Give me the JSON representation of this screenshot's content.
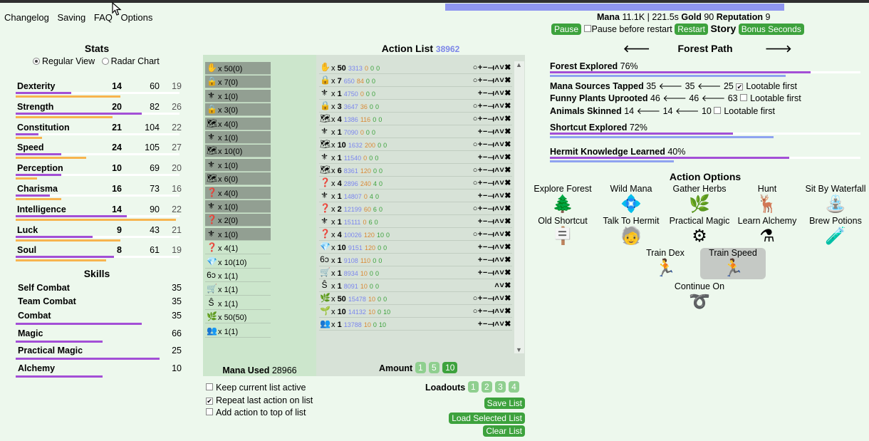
{
  "menu": [
    "Changelog",
    "Saving",
    "FAQ",
    "Options"
  ],
  "stats": {
    "title": "Stats",
    "view_regular": "Regular View",
    "view_radar": "Radar Chart",
    "rows": [
      {
        "name": "Dexterity",
        "level": "14",
        "talent": "60",
        "soul": "19",
        "level_frac": 0.34,
        "talent_frac": 0.64
      },
      {
        "name": "Strength",
        "level": "20",
        "talent": "82",
        "soul": "26",
        "level_frac": 0.77,
        "talent_frac": 0.59
      },
      {
        "name": "Constitution",
        "level": "21",
        "talent": "104",
        "soul": "22",
        "level_frac": 0.14,
        "talent_frac": 0.16
      },
      {
        "name": "Speed",
        "level": "24",
        "talent": "105",
        "soul": "27",
        "level_frac": 0.28,
        "talent_frac": 0.43
      },
      {
        "name": "Perception",
        "level": "10",
        "talent": "69",
        "soul": "20",
        "level_frac": 0.28,
        "talent_frac": 0.13
      },
      {
        "name": "Charisma",
        "level": "16",
        "talent": "73",
        "soul": "16",
        "level_frac": 0.21,
        "talent_frac": 0.28
      },
      {
        "name": "Intelligence",
        "level": "14",
        "talent": "90",
        "soul": "22",
        "level_frac": 0.68,
        "talent_frac": 0.98
      },
      {
        "name": "Luck",
        "level": "9",
        "talent": "43",
        "soul": "21",
        "level_frac": 0.47,
        "talent_frac": 0.64
      },
      {
        "name": "Soul",
        "level": "8",
        "talent": "61",
        "soul": "19",
        "level_frac": 0.6,
        "talent_frac": 0.55
      }
    ]
  },
  "skills": {
    "title": "Skills",
    "rows": [
      {
        "name": "Self Combat",
        "level": "35",
        "frac": 0
      },
      {
        "name": "Team Combat",
        "level": "35",
        "frac": 0
      },
      {
        "name": "Combat",
        "level": "35",
        "frac": 0.77
      },
      {
        "name": "Magic",
        "level": "66",
        "frac": 0.53
      },
      {
        "name": "Practical Magic",
        "level": "25",
        "frac": 0.88
      },
      {
        "name": "Alchemy",
        "level": "10",
        "frac": 0.53
      }
    ]
  },
  "action_list": {
    "title": "Action List",
    "count": "38962"
  },
  "next_list": [
    {
      "icon": "✋",
      "count": "50(0)",
      "dim": true
    },
    {
      "icon": "🔒",
      "count": "7(0)",
      "dim": true
    },
    {
      "icon": "⚜",
      "count": "1(0)",
      "dim": true
    },
    {
      "icon": "🔒",
      "count": "3(0)",
      "dim": true
    },
    {
      "icon": "🗺",
      "count": "4(0)",
      "dim": true
    },
    {
      "icon": "⚜",
      "count": "1(0)",
      "dim": true
    },
    {
      "icon": "🗺",
      "count": "10(0)",
      "dim": true
    },
    {
      "icon": "⚜",
      "count": "1(0)",
      "dim": true
    },
    {
      "icon": "🗺",
      "count": "6(0)",
      "dim": true
    },
    {
      "icon": "❓",
      "count": "4(0)",
      "dim": true
    },
    {
      "icon": "⚜",
      "count": "1(0)",
      "dim": true
    },
    {
      "icon": "❓",
      "count": "2(0)",
      "dim": true
    },
    {
      "icon": "⚜",
      "count": "1(0)",
      "dim": true
    },
    {
      "icon": "❓",
      "count": "4(1)",
      "dim": false
    },
    {
      "icon": "💎",
      "count": "10(10)",
      "dim": false
    },
    {
      "icon": "6ɔ",
      "count": "1(1)",
      "dim": false
    },
    {
      "icon": "🛒",
      "count": "1(1)",
      "dim": false
    },
    {
      "icon": "Ŝ",
      "count": "1(1)",
      "dim": false
    },
    {
      "icon": "🌿",
      "count": "50(50)",
      "dim": false
    },
    {
      "icon": "👥",
      "count": "1(1)",
      "dim": false
    }
  ],
  "current_list": [
    {
      "icon": "✋",
      "count": "50",
      "mana": "3313",
      "a": "0",
      "b": "0",
      "c": "0",
      "circle": true,
      "plus": true
    },
    {
      "icon": "🔒",
      "count": "7",
      "mana": "650",
      "a": "84",
      "b": "0",
      "c": "0",
      "circle": true,
      "plus": false
    },
    {
      "icon": "⚜",
      "count": "1",
      "mana": "4750",
      "a": "0",
      "b": "0",
      "c": "0",
      "circle": false,
      "plus": true
    },
    {
      "icon": "🔒",
      "count": "3",
      "mana": "3647",
      "a": "36",
      "b": "0",
      "c": "0",
      "circle": true,
      "plus": true
    },
    {
      "icon": "🗺",
      "count": "4",
      "mana": "1386",
      "a": "116",
      "b": "0",
      "c": "0",
      "circle": true,
      "plus": true
    },
    {
      "icon": "⚜",
      "count": "1",
      "mana": "7090",
      "a": "0",
      "b": "0",
      "c": "0",
      "circle": false,
      "plus": true
    },
    {
      "icon": "🗺",
      "count": "10",
      "mana": "1632",
      "a": "200",
      "b": "0",
      "c": "0",
      "circle": true,
      "plus": true
    },
    {
      "icon": "⚜",
      "count": "1",
      "mana": "11540",
      "a": "0",
      "b": "0",
      "c": "0",
      "circle": false,
      "plus": true
    },
    {
      "icon": "🗺",
      "count": "6",
      "mana": "8361",
      "a": "120",
      "b": "0",
      "c": "0",
      "circle": true,
      "plus": true
    },
    {
      "icon": "❓",
      "count": "4",
      "mana": "2896",
      "a": "240",
      "b": "4",
      "c": "0",
      "circle": true,
      "plus": true
    },
    {
      "icon": "⚜",
      "count": "1",
      "mana": "14807",
      "a": "0",
      "b": "4",
      "c": "0",
      "circle": false,
      "plus": true
    },
    {
      "icon": "❓",
      "count": "2",
      "mana": "12199",
      "a": "60",
      "b": "6",
      "c": "0",
      "circle": true,
      "plus": true
    },
    {
      "icon": "⚜",
      "count": "1",
      "mana": "15111",
      "a": "0",
      "b": "6",
      "c": "0",
      "circle": false,
      "plus": true
    },
    {
      "icon": "❓",
      "count": "4",
      "mana": "10026",
      "a": "120",
      "b": "10",
      "c": "0",
      "circle": true,
      "plus": true
    },
    {
      "icon": "💎",
      "count": "10",
      "mana": "9151",
      "a": "120",
      "b": "0",
      "c": "0",
      "circle": false,
      "plus": true
    },
    {
      "icon": "6ɔ",
      "count": "1",
      "mana": "9108",
      "a": "110",
      "b": "0",
      "c": "0",
      "circle": false,
      "plus": true
    },
    {
      "icon": "🛒",
      "count": "1",
      "mana": "8934",
      "a": "10",
      "b": "0",
      "c": "0",
      "circle": false,
      "plus": true
    },
    {
      "icon": "Ŝ",
      "count": "1",
      "mana": "8091",
      "a": "10",
      "b": "0",
      "c": "0",
      "circle": false,
      "plus": false,
      "minimal": true
    },
    {
      "icon": "🌿",
      "count": "50",
      "mana": "15478",
      "a": "10",
      "b": "0",
      "c": "0",
      "circle": true,
      "plus": true
    },
    {
      "icon": "🌱",
      "count": "10",
      "mana": "14132",
      "a": "10",
      "b": "0",
      "c": "10",
      "circle": true,
      "plus": true
    },
    {
      "icon": "👥",
      "count": "1",
      "mana": "13788",
      "a": "10",
      "b": "0",
      "c": "10",
      "circle": false,
      "plus": true
    }
  ],
  "mana_used": {
    "label": "Mana Used",
    "value": "28966"
  },
  "amount": {
    "label": "Amount",
    "options": [
      "1",
      "5",
      "10"
    ]
  },
  "checks": [
    {
      "label": "Keep current list active",
      "checked": false
    },
    {
      "label": "Repeat last action on list",
      "checked": true
    },
    {
      "label": "Add action to top of list",
      "checked": false
    }
  ],
  "loadouts": {
    "label": "Loadouts",
    "options": [
      "1",
      "2",
      "3",
      "4"
    ],
    "save": "Save List",
    "load": "Load Selected List",
    "clear": "Clear List"
  },
  "status": {
    "mana_label": "Mana",
    "mana": "11.1K | 221.5s",
    "gold_label": "Gold",
    "gold": "90",
    "rep_label": "Reputation",
    "rep": "9"
  },
  "controls": {
    "pause": "Pause",
    "pause_before": "Pause before restart",
    "restart": "Restart",
    "story": "Story",
    "bonus": "Bonus Seconds"
  },
  "town": {
    "name": "Forest Path",
    "prev": "🡐",
    "next": "🡒"
  },
  "progress": [
    {
      "label": "Forest Explored",
      "pct": "76%",
      "p": 0.84,
      "b": 0.76
    },
    {
      "label": "Shortcut Explored",
      "pct": "72%",
      "p": 0.59,
      "b": 0.72
    },
    {
      "label": "Hermit Knowledge Learned",
      "pct": "40%",
      "p": 0.77,
      "b": 0.4
    }
  ],
  "lootables": [
    {
      "label": "Mana Sources Tapped",
      "v1": "35",
      "v2": "35",
      "v3": "25",
      "opt": "Lootable first",
      "checked": true
    },
    {
      "label": "Funny Plants Uprooted",
      "v1": "46",
      "v2": "46",
      "v3": "63",
      "opt": "Lootable first",
      "checked": false
    },
    {
      "label": "Animals Skinned",
      "v1": "14",
      "v2": "14",
      "v3": "10",
      "opt": "Lootable first",
      "checked": false
    }
  ],
  "action_options": {
    "title": "Action Options",
    "items": [
      {
        "label": "Explore Forest",
        "icon": "🌲"
      },
      {
        "label": "Wild Mana",
        "icon": "💠"
      },
      {
        "label": "Gather Herbs",
        "icon": "🌿"
      },
      {
        "label": "Hunt",
        "icon": "🦌"
      },
      {
        "label": "Sit By Waterfall",
        "icon": "⛲"
      },
      {
        "label": "Old Shortcut",
        "icon": "🪧"
      },
      {
        "label": "Talk To Hermit",
        "icon": "🧓"
      },
      {
        "label": "Practical Magic",
        "icon": "⚙"
      },
      {
        "label": "Learn Alchemy",
        "icon": "⚗"
      },
      {
        "label": "Brew Potions",
        "icon": "🧪"
      },
      {
        "label": "Train Dex",
        "icon": "🏃"
      },
      {
        "label": "Train Speed",
        "icon": "🏃"
      },
      {
        "label": "Continue On",
        "icon": "➰"
      }
    ]
  },
  "colors": {
    "purple": "#a34fd6",
    "orange": "#f7b44f",
    "green_btn": "#3da23d",
    "blue": "#8f96f0",
    "bg": "#edf8ed"
  }
}
